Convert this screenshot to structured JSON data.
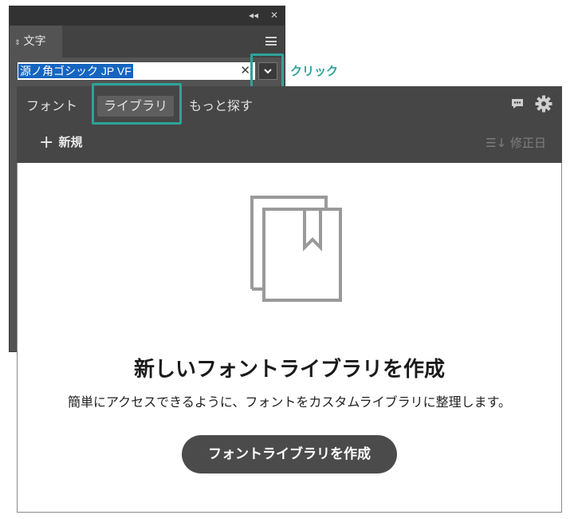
{
  "panel": {
    "collapse_glyph": "◂◂",
    "close_glyph": "✕",
    "tab_label": "文字",
    "tab_arrows": "⇕",
    "font_field_value": "源ノ角ゴシック JP VF",
    "clear_glyph": "✕"
  },
  "annotation": {
    "click_label": "クリック",
    "highlight_color": "#2ea39a"
  },
  "popup": {
    "tabs": [
      "フォント",
      "ライブラリ",
      "もっと探す"
    ],
    "active_tab": "ライブラリ",
    "new_label": "新規",
    "new_glyph": "+",
    "sort_label": "修正日",
    "sort_glyph": "☰↓",
    "empty_title": "新しいフォントライブラリを作成",
    "empty_description": "簡単にアクセスできるように、フォントをカスタムライブラリに整理します。",
    "create_button": "フォントライブラリを作成"
  },
  "icons": [
    "chevron-down-icon",
    "comment-icon",
    "gear-icon",
    "plus-icon",
    "sort-icon",
    "library-illustration-icon",
    "menu-icon"
  ]
}
